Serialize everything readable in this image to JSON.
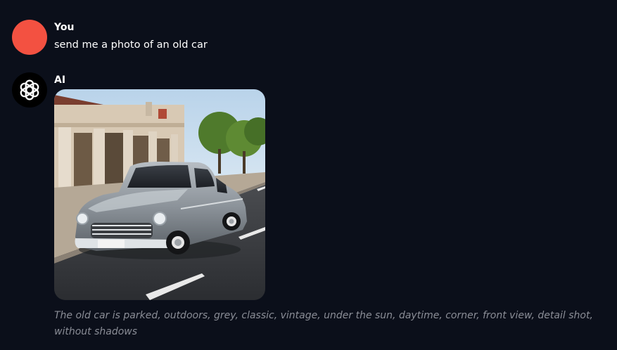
{
  "messages": {
    "user": {
      "name": "You",
      "text": "send me a photo of an old car",
      "avatar_color": "#f35141"
    },
    "ai": {
      "name": "AI",
      "avatar_icon": "openai-logo-icon",
      "image_subject": "old grey car parked on street",
      "caption": "The old car is parked, outdoors, grey, classic, vintage, under the sun, daytime, corner, front view, detail shot, without shadows"
    }
  },
  "colors": {
    "background": "#0b0f1a",
    "caption_text": "#8a8d96"
  }
}
